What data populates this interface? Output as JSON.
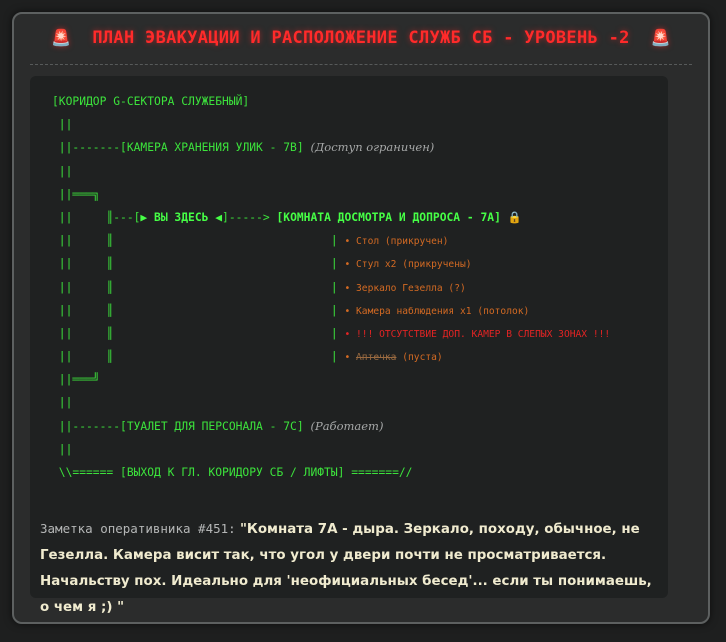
{
  "header": {
    "siren_left": "🚨",
    "title": "ПЛАН ЭВАКУАЦИИ И РАСПОЛОЖЕНИЕ СЛУЖБ СБ - УРОВЕНЬ -2",
    "siren_right": "🚨"
  },
  "map": {
    "corridor": "[КОРИДОР G-СЕКТОРА СЛУЖЕБНЫЙ]",
    "v": " ||",
    "evidence_prefix": " ||-------",
    "evidence_room": "[КАМЕРА ХРАНЕНИЯ УЛИК - 7В]",
    "evidence_status": "(Доступ ограничен)",
    "branch_top": " ||═══╗",
    "here_prefix": " ||     ║---[",
    "here_label": "▶ ВЫ ЗДЕСЬ ◀",
    "here_arrow": "]-----> ",
    "interrogation_room": "[КОМНАТА ДОСМОТРА И ДОПРОСА - 7А]",
    "lock_icon": "🔒",
    "branch_mid": " ||     ║                                ",
    "items": [
      "• Стол (прикручен)",
      "• Стул x2 (прикручены)",
      "• Зеркало Гезелла (?)",
      "• Камера наблюдения x1 (потолок)"
    ],
    "warning": "• !!! ОТСУТСТВИЕ ДОП. КАМЕР В СЛЕПЫХ ЗОНАХ !!!",
    "kit_bullet": "• ",
    "kit_struck": "Аптечка",
    "kit_status": " (пуста)",
    "branch_bottom": " ||═══╝",
    "toilet_prefix": " ||-------",
    "toilet_room": "[ТУАЛЕТ ДЛЯ ПЕРСОНАЛА - 7С]",
    "toilet_status": "(Работает)",
    "exit_line": " \\\\====== [ВЫХОД К ГЛ. КОРИДОРУ СБ / ЛИФТЫ] =======//"
  },
  "note": {
    "label": "Заметка оперативника #451:",
    "text": "\"Комната 7А - дыра. Зеркало, походу, обычное, не Гезелла. Камера висит так, что угол у двери почти не просматривается. Начальству пох. Идеально для 'неофициальных бесед'... если ты понимаешь, о чем я ;) \""
  }
}
